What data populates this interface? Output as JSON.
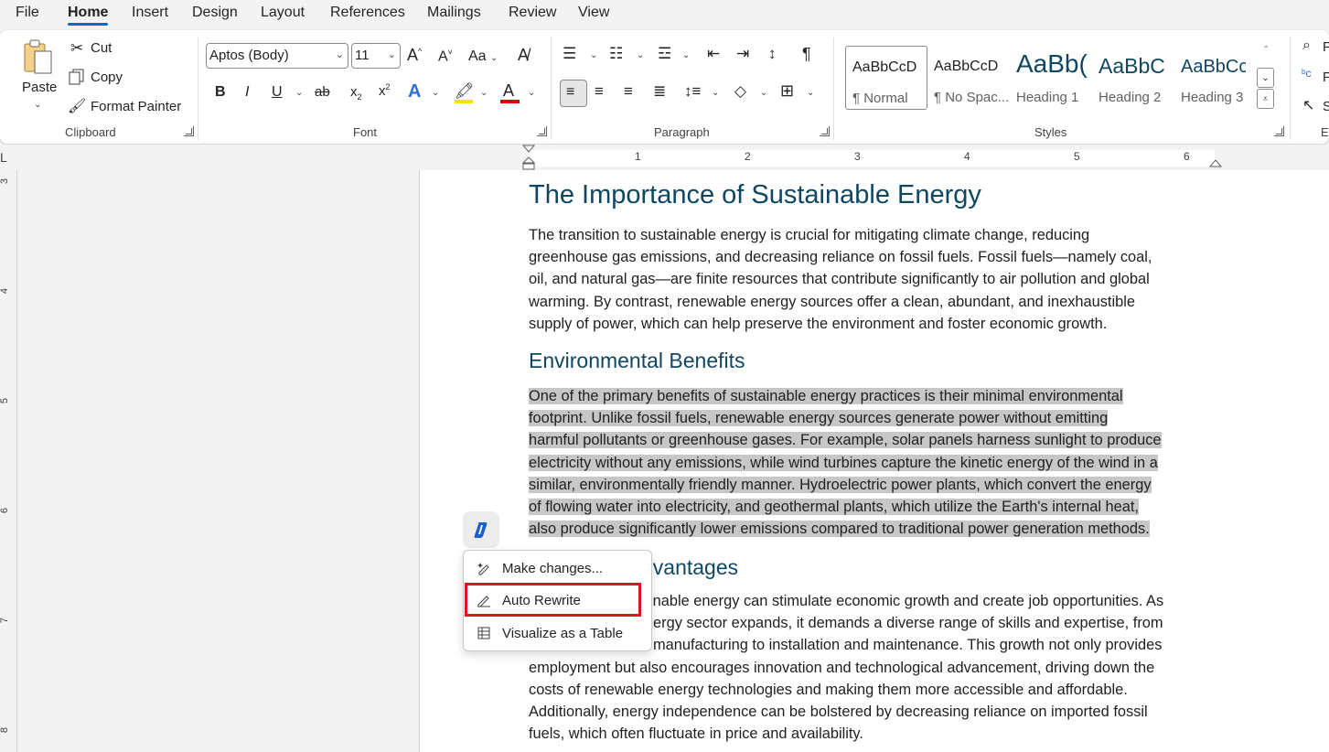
{
  "menu_tabs": [
    "File",
    "Home",
    "Insert",
    "Design",
    "Layout",
    "References",
    "Mailings",
    "Review",
    "View"
  ],
  "clipboard": {
    "paste": "Paste",
    "cut": "Cut",
    "copy": "Copy",
    "format_painter": "Format Painter",
    "group": "Clipboard"
  },
  "font": {
    "name": "Aptos (Body)",
    "size": "11",
    "change_case": "Aa",
    "group": "Font"
  },
  "paragraph": {
    "group": "Paragraph"
  },
  "styles": {
    "group": "Styles",
    "items": [
      {
        "preview": "AaBbCcD",
        "name": "¶ Normal"
      },
      {
        "preview": "AaBbCcD",
        "name": "¶ No Spac..."
      },
      {
        "preview": "AaBb(",
        "name": "Heading 1"
      },
      {
        "preview": "AaBbC",
        "name": "Heading 2"
      },
      {
        "preview": "AaBbCc",
        "name": "Heading 3"
      }
    ]
  },
  "editing": {
    "find": "F",
    "replace": "F",
    "select": "S",
    "group": "E"
  },
  "ruler": {
    "numbers": [
      "1",
      "2",
      "3",
      "4",
      "5",
      "6"
    ],
    "vertical_numbers": [
      "3",
      "4",
      "5",
      "6",
      "7",
      "8"
    ]
  },
  "document": {
    "title": "The Importance of Sustainable Energy",
    "intro_lines": [
      "The transition to sustainable energy is crucial for mitigating climate change, reducing",
      "greenhouse gas emissions, and decreasing reliance on fossil fuels. Fossil fuels—namely coal,",
      "oil, and natural gas—are finite resources that contribute significantly to air pollution and global",
      "warming. By contrast, renewable energy sources offer a clean, abundant, and inexhaustible",
      "supply of power, which can help preserve the environment and foster economic growth."
    ],
    "heading_env": "Environmental Benefits",
    "env_lines": [
      "One of the primary benefits of sustainable energy practices is their minimal environmental",
      "footprint. Unlike fossil fuels, renewable energy sources generate power without emitting",
      "harmful pollutants or greenhouse gases. For example, solar panels harness sunlight to produce",
      "electricity without any emissions, while wind turbines capture the kinetic energy of the wind in a",
      "similar, environmentally friendly manner. Hydroelectric power plants, which convert the energy",
      "of flowing water into electricity, and geothermal plants, which utilize the Earth's internal heat,",
      "also produce significantly lower emissions compared to traditional power generation methods."
    ],
    "heading_econ_visible": "dvantages",
    "econ_lines": [
      "inable energy can stimulate economic growth and create job opportunities. As",
      "ergy sector expands, it demands a diverse range of skills and expertise, from",
      "manufacturing to installation and maintenance. This growth not only provides",
      "employment but also encourages innovation and technological advancement, driving down the",
      "costs of renewable energy technologies and making them more accessible and affordable.",
      "Additionally, energy independence can be bolstered by decreasing reliance on imported fossil",
      "fuels, which often fluctuate in price and availability."
    ]
  },
  "copilot_menu": {
    "items": [
      "Make changes...",
      "Auto Rewrite",
      "Visualize as a Table"
    ]
  },
  "colors": {
    "accent": "#0f6cbd",
    "heading": "#0f4761",
    "highlight": "#c7c7c7",
    "annotation": "#e1131f"
  }
}
